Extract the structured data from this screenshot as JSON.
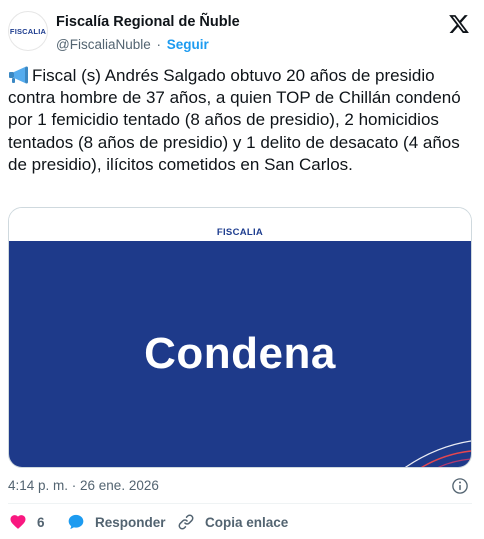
{
  "post": {
    "author_name": "Fiscalía Regional de Ñuble",
    "handle": "@FiscaliaNuble",
    "separator": "·",
    "follow_label": "Seguir",
    "avatar_text": "FISCALIA",
    "text": "Fiscal (s) Andrés Salgado obtuvo 20 años de presidio contra hombre de 37 años, a quien TOP de Chillán condenó por 1 femicidio tentado (8 años de presidio), 2 homicidios tentados (8 años de presidio) y 1 delito de desacato (4 años de presidio), ilícitos cometidos en San Carlos.",
    "timestamp": "4:14 p. m. · 26 ene. 2026"
  },
  "media": {
    "logo_text": "FISCALIA",
    "title": "Condena",
    "colors": {
      "background": "#1e3a8a",
      "logo": "#1e3d8f",
      "accent": "#e4474f"
    }
  },
  "actions": {
    "like_count": "6",
    "reply_label": "Responder",
    "copy_label": "Copia enlace"
  },
  "icons": {
    "emoji": "megaphone-icon",
    "brand": "x-logo-icon",
    "info": "info-icon",
    "like": "heart-icon",
    "reply": "speech-bubble-icon",
    "copy": "link-icon"
  },
  "colors": {
    "text": "#0f1419",
    "secondary": "#536471",
    "link": "#1d9bf0",
    "heart": "#f91880",
    "reply": "#1d9bf0"
  }
}
